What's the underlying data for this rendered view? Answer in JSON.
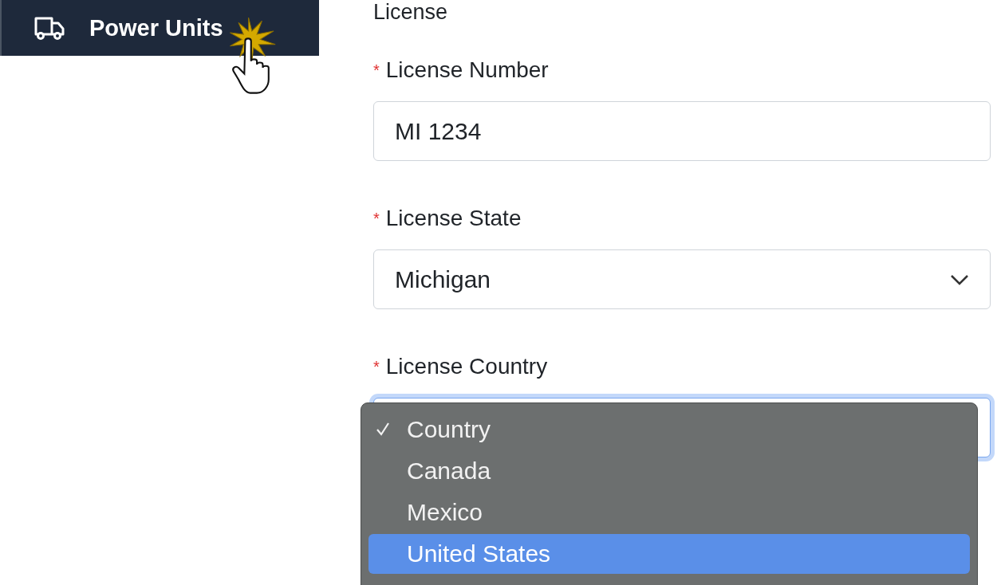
{
  "sidebar": {
    "items": [
      {
        "label": "Power Units",
        "selected": true
      }
    ]
  },
  "form": {
    "section_title": "License",
    "fields": [
      {
        "label": "License Number",
        "required_marker": "*",
        "kind": "text",
        "value": "MI 1234",
        "focused": false
      },
      {
        "label": "License State",
        "required_marker": "*",
        "kind": "select",
        "value": "Michigan",
        "focused": false
      },
      {
        "label": "License Country",
        "required_marker": "*",
        "kind": "select",
        "focused": true
      }
    ]
  },
  "dropdown": {
    "options": [
      {
        "label": "Country",
        "checked": true,
        "highlighted": false
      },
      {
        "label": "Canada",
        "checked": false,
        "highlighted": false
      },
      {
        "label": "Mexico",
        "checked": false,
        "highlighted": false
      },
      {
        "label": "United States",
        "checked": false,
        "highlighted": true
      }
    ]
  }
}
